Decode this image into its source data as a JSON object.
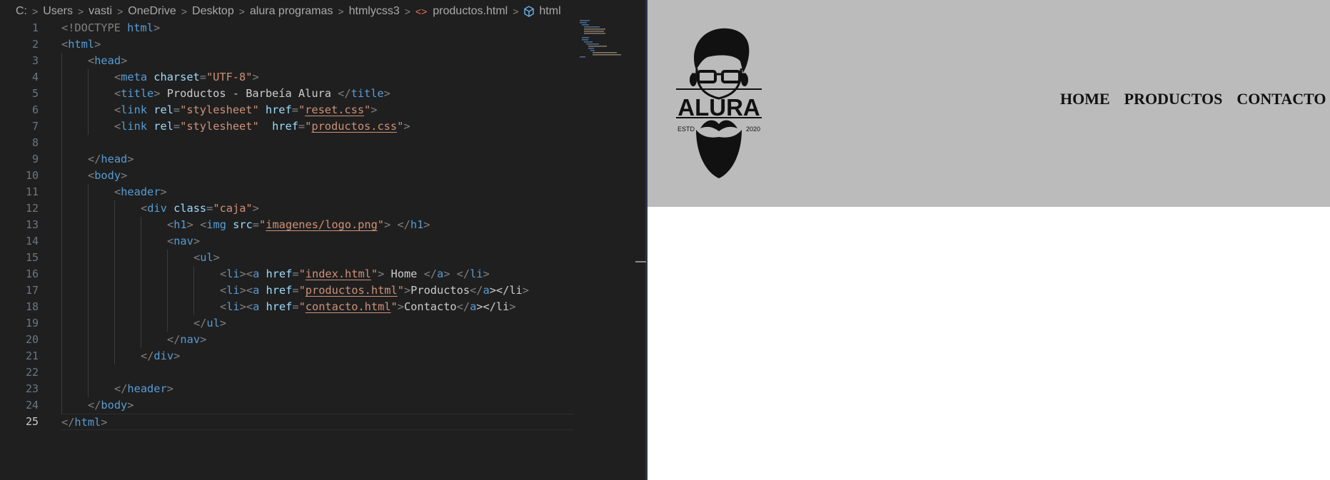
{
  "breadcrumb": {
    "items": [
      "C:",
      "Users",
      "vasti",
      "OneDrive",
      "Desktop",
      "alura programas",
      "htmlycss3"
    ],
    "file_icon": "<>",
    "file": "productos.html",
    "symbol": "html"
  },
  "editor": {
    "active_line": 25,
    "line_numbers": [
      "1",
      "2",
      "3",
      "4",
      "5",
      "6",
      "7",
      "8",
      "9",
      "10",
      "11",
      "12",
      "13",
      "14",
      "15",
      "16",
      "17",
      "18",
      "19",
      "20",
      "21",
      "22",
      "23",
      "24",
      "25"
    ],
    "lines": [
      [
        "<!DOCTYPE ",
        "html",
        ">"
      ],
      [
        "<",
        "html",
        ">"
      ],
      [
        "<",
        "head",
        ">"
      ],
      [
        "<",
        "meta",
        " ",
        "charset",
        "=",
        "\"UTF-8\"",
        ">"
      ],
      [
        "<",
        "title",
        ">",
        " Productos - Barbeía Alura ",
        "</",
        "title",
        ">"
      ],
      [
        "<",
        "link",
        " ",
        "rel",
        "=",
        "\"stylesheet\"",
        " ",
        "href",
        "=",
        "\"",
        "reset.css",
        "\"",
        ">"
      ],
      [
        "<",
        "link",
        " ",
        "rel",
        "=",
        "\"stylesheet\"",
        "  ",
        "href",
        "=",
        "\"",
        "productos.css",
        "\"",
        ">"
      ],
      [],
      [
        "</",
        "head",
        ">"
      ],
      [
        "<",
        "body",
        ">"
      ],
      [
        "<",
        "header",
        ">"
      ],
      [
        "<",
        "div",
        " ",
        "class",
        "=",
        "\"caja\"",
        ">"
      ],
      [
        "<",
        "h1",
        ">",
        " ",
        "<",
        "img",
        " ",
        "src",
        "=",
        "\"",
        "imagenes/logo.png",
        "\"",
        ">",
        " ",
        "</",
        "h1",
        ">"
      ],
      [
        "<",
        "nav",
        ">"
      ],
      [
        "<",
        "ul",
        ">"
      ],
      [
        "<",
        "li",
        "><",
        "a",
        " ",
        "href",
        "=",
        "\"",
        "index.html",
        "\"",
        ">",
        " Home ",
        "</",
        "a",
        ">",
        " ",
        "</",
        "li",
        ">"
      ],
      [
        "<",
        "li",
        "><",
        "a",
        " ",
        "href",
        "=",
        "\"",
        "productos.html",
        "\"",
        ">",
        "Productos",
        "</",
        "a",
        "></",
        "li",
        ">"
      ],
      [
        "<",
        "li",
        "><",
        "a",
        " ",
        "href",
        "=",
        "\"",
        "contacto.html",
        "\"",
        ">",
        "Contacto",
        "</",
        "a",
        "></",
        "li",
        ">"
      ],
      [
        "</",
        "ul",
        ">"
      ],
      [
        "</",
        "nav",
        ">"
      ],
      [
        "</",
        "div",
        ">"
      ],
      [],
      [
        "</",
        "header",
        ">"
      ],
      [
        "</",
        "body",
        ">"
      ],
      [
        "</",
        "html",
        ">"
      ]
    ]
  },
  "preview": {
    "header_bg": "#bbbbbb",
    "logo": {
      "brand": "ALURA",
      "left_text": "ESTD",
      "right_text": "2020"
    },
    "nav": [
      {
        "label": "HOME"
      },
      {
        "label": "PRODUCTOS"
      },
      {
        "label": "CONTACTO"
      }
    ]
  }
}
